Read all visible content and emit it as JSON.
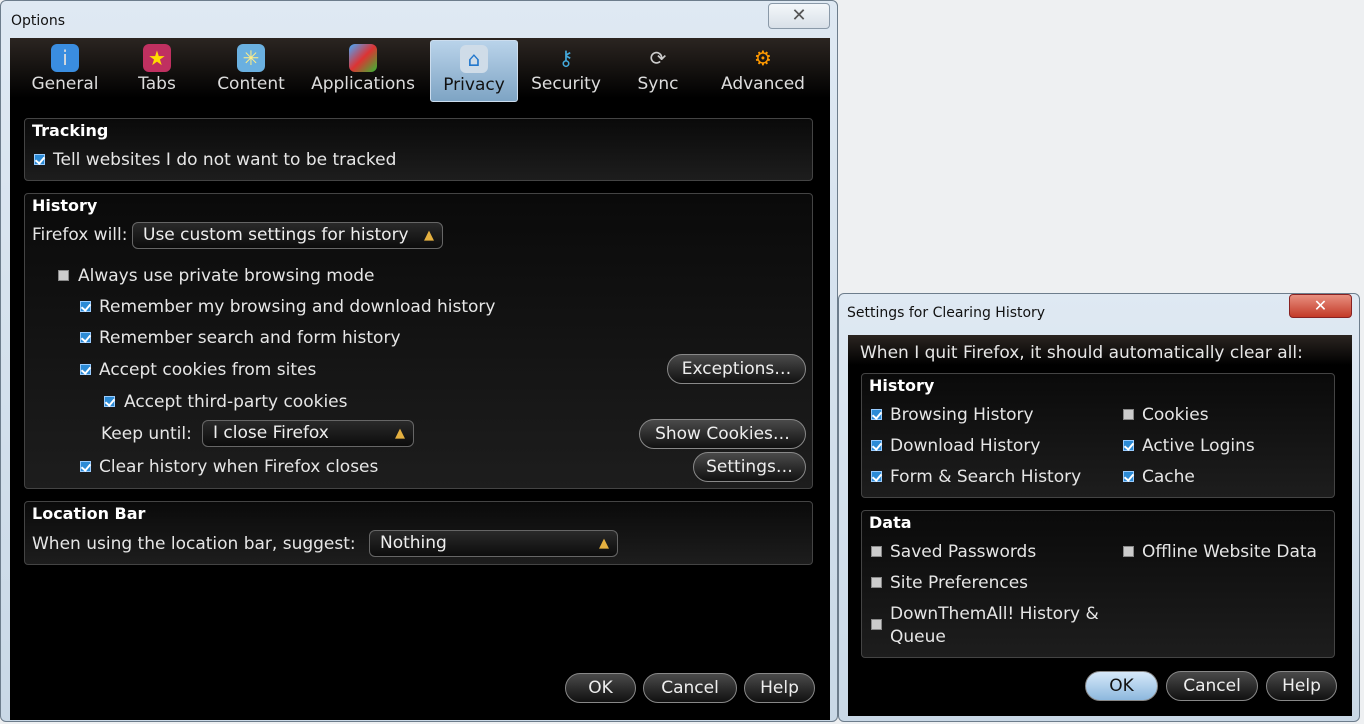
{
  "options": {
    "title": "Options",
    "tabs": [
      {
        "label": "General",
        "icon": "general-icon"
      },
      {
        "label": "Tabs",
        "icon": "tabs-icon"
      },
      {
        "label": "Content",
        "icon": "content-icon"
      },
      {
        "label": "Applications",
        "icon": "applications-icon"
      },
      {
        "label": "Privacy",
        "icon": "privacy-icon",
        "selected": true
      },
      {
        "label": "Security",
        "icon": "security-icon"
      },
      {
        "label": "Sync",
        "icon": "sync-icon"
      },
      {
        "label": "Advanced",
        "icon": "advanced-icon"
      }
    ],
    "tracking": {
      "header": "Tracking",
      "dnt": "Tell websites I do not want to be tracked"
    },
    "history": {
      "header": "History",
      "firefox_will": "Firefox will:",
      "mode": "Use custom settings for history",
      "private": "Always use private browsing mode",
      "remember_browsing": "Remember my browsing and download history",
      "remember_search": "Remember search and form history",
      "accept_cookies": "Accept cookies from sites",
      "exceptions": "Exceptions…",
      "third_party": "Accept third-party cookies",
      "keep_until": "Keep until:",
      "keep_value": "I close Firefox",
      "show_cookies": "Show Cookies…",
      "clear_on_close": "Clear history when Firefox closes",
      "settings": "Settings…"
    },
    "location": {
      "header": "Location Bar",
      "suggest": "When using the location bar, suggest:",
      "suggest_value": "Nothing"
    },
    "buttons": {
      "ok": "OK",
      "cancel": "Cancel",
      "help": "Help"
    }
  },
  "clear": {
    "title": "Settings for Clearing History",
    "intro": "When I quit Firefox, it should automatically clear all:",
    "history_header": "History",
    "browsing": "Browsing History",
    "download": "Download History",
    "form": "Form & Search History",
    "cookies": "Cookies",
    "logins": "Active Logins",
    "cache": "Cache",
    "data_header": "Data",
    "passwords": "Saved Passwords",
    "site_prefs": "Site Preferences",
    "dta1": "DownThemAll! History &",
    "dta2": "Queue",
    "offline": "Offline Website Data",
    "buttons": {
      "ok": "OK",
      "cancel": "Cancel",
      "help": "Help"
    }
  }
}
